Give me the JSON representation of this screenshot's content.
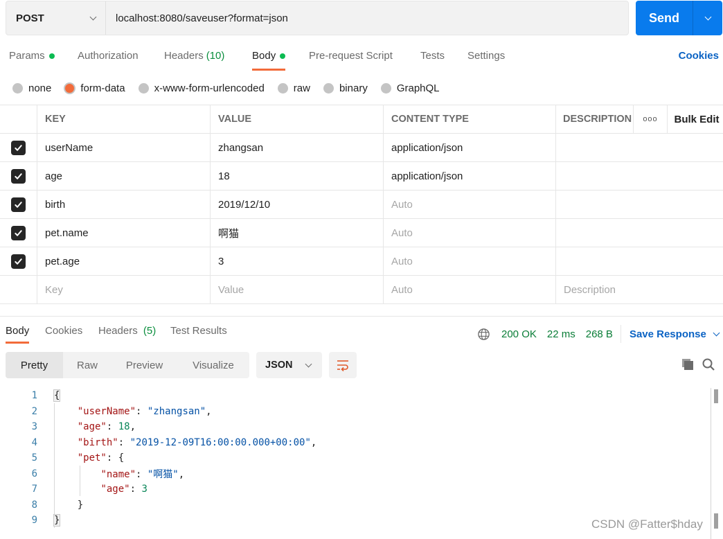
{
  "request": {
    "method": "POST",
    "url": "localhost:8080/saveuser?format=json",
    "send_label": "Send"
  },
  "req_tabs": {
    "params": "Params",
    "authorization": "Authorization",
    "headers": "Headers",
    "headers_count": "(10)",
    "body": "Body",
    "prerequest": "Pre-request Script",
    "tests": "Tests",
    "settings": "Settings",
    "cookies": "Cookies",
    "active": "Body"
  },
  "body_types": {
    "options": [
      "none",
      "form-data",
      "x-www-form-urlencoded",
      "raw",
      "binary",
      "GraphQL"
    ],
    "selected": "form-data"
  },
  "form_table": {
    "headers": {
      "key": "KEY",
      "value": "VALUE",
      "content_type": "CONTENT TYPE",
      "description": "DESCRIPTION",
      "more": "ooo",
      "bulk_edit": "Bulk Edit"
    },
    "rows": [
      {
        "checked": true,
        "key": "userName",
        "value": "zhangsan",
        "content_type": "application/json",
        "content_type_placeholder": false
      },
      {
        "checked": true,
        "key": "age",
        "value": "18",
        "content_type": "application/json",
        "content_type_placeholder": false
      },
      {
        "checked": true,
        "key": "birth",
        "value": "2019/12/10",
        "content_type": "Auto",
        "content_type_placeholder": true
      },
      {
        "checked": true,
        "key": "pet.name",
        "value": "啊猫",
        "content_type": "Auto",
        "content_type_placeholder": true
      },
      {
        "checked": true,
        "key": "pet.age",
        "value": "3",
        "content_type": "Auto",
        "content_type_placeholder": true
      }
    ],
    "placeholder_row": {
      "key": "Key",
      "value": "Value",
      "content_type": "Auto",
      "description": "Description"
    }
  },
  "response": {
    "tabs": {
      "body": "Body",
      "cookies": "Cookies",
      "headers": "Headers",
      "headers_count": "(5)",
      "test_results": "Test Results",
      "active": "Body"
    },
    "status": "200 OK",
    "time": "22 ms",
    "size": "268 B",
    "save_response": "Save Response",
    "view_modes": [
      "Pretty",
      "Raw",
      "Preview",
      "Visualize"
    ],
    "active_view": "Pretty",
    "format": "JSON",
    "code_lines": [
      {
        "n": "1"
      },
      {
        "n": "2"
      },
      {
        "n": "3"
      },
      {
        "n": "4"
      },
      {
        "n": "5"
      },
      {
        "n": "6"
      },
      {
        "n": "7"
      },
      {
        "n": "8"
      },
      {
        "n": "9"
      }
    ],
    "json": {
      "userName_key": "\"userName\"",
      "userName_val": "\"zhangsan\"",
      "age_key": "\"age\"",
      "age_val": "18",
      "birth_key": "\"birth\"",
      "birth_val": "\"2019-12-09T16:00:00.000+00:00\"",
      "pet_key": "\"pet\"",
      "name_key": "\"name\"",
      "name_val": "\"啊猫\"",
      "pet_age_key": "\"age\"",
      "pet_age_val": "3"
    }
  },
  "watermark": "CSDN @Fatter$hday",
  "colors": {
    "accent_orange": "#f26b3a",
    "send_blue": "#097bed",
    "link_blue": "#0b63c4",
    "status_green": "#0a7d37"
  }
}
